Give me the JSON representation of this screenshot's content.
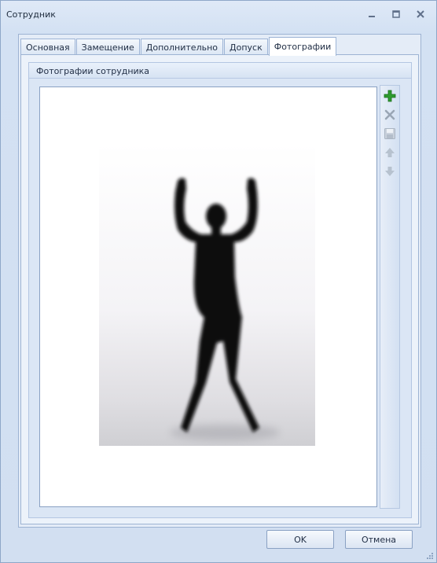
{
  "window": {
    "title": "Сотрудник",
    "controls": {
      "minimize": "minimize-icon",
      "maximize": "maximize-icon",
      "close": "close-icon"
    }
  },
  "tabs": [
    {
      "label": "Основная",
      "active": false
    },
    {
      "label": "Замещение",
      "active": false
    },
    {
      "label": "Дополнительно",
      "active": false
    },
    {
      "label": "Допуск",
      "active": false
    },
    {
      "label": "Фотографии",
      "active": true
    }
  ],
  "photos_group": {
    "title": "Фотографии сотрудника",
    "photo_icon": "silhouette-photo"
  },
  "toolbar": [
    {
      "icon": "add-icon",
      "enabled": true
    },
    {
      "icon": "delete-icon",
      "enabled": false
    },
    {
      "icon": "save-icon",
      "enabled": false
    },
    {
      "icon": "move-up-icon",
      "enabled": false
    },
    {
      "icon": "move-down-icon",
      "enabled": false
    }
  ],
  "buttons": {
    "ok": "OK",
    "cancel": "Отмена"
  },
  "colors": {
    "accent": "#2e9b2e",
    "disabled": "#b7c2cf",
    "border": "#8aa1c3"
  }
}
